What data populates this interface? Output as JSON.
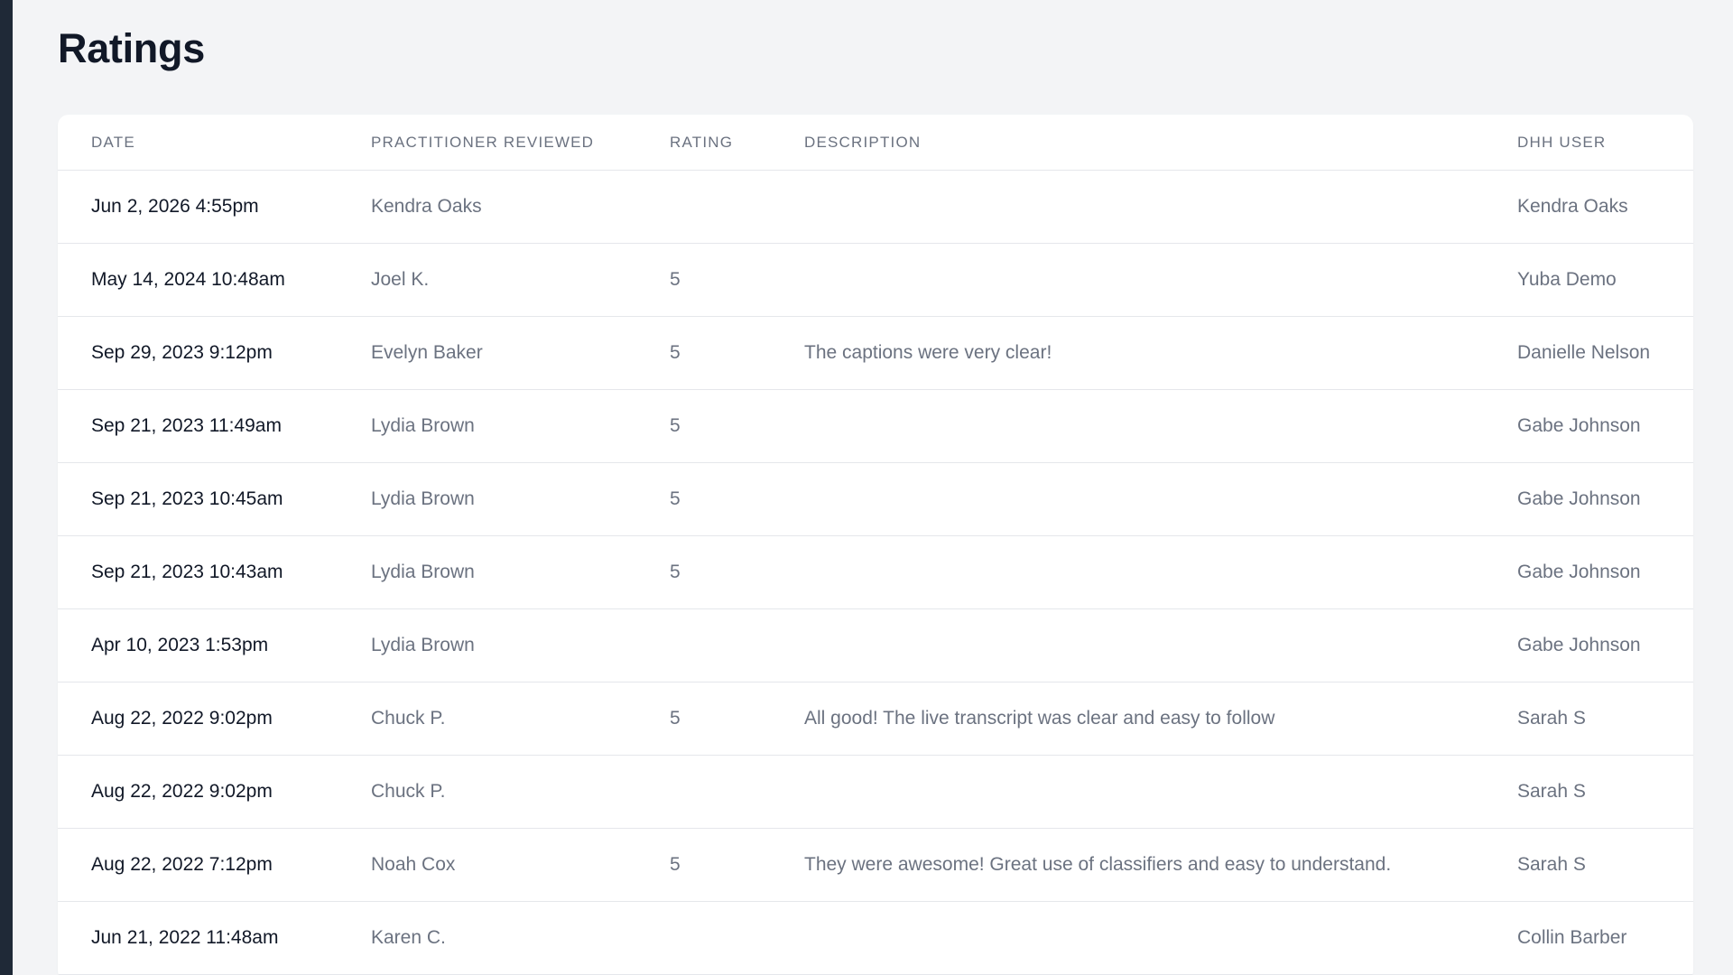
{
  "page": {
    "title": "Ratings"
  },
  "table": {
    "headers": {
      "date": "DATE",
      "practitioner": "PRACTITIONER REVIEWED",
      "rating": "RATING",
      "description": "DESCRIPTION",
      "user": "DHH USER"
    },
    "rows": [
      {
        "date": "Jun 2, 2026 4:55pm",
        "practitioner": "Kendra Oaks",
        "rating": "",
        "description": "",
        "user": "Kendra Oaks"
      },
      {
        "date": "May 14, 2024 10:48am",
        "practitioner": "Joel K.",
        "rating": "5",
        "description": "",
        "user": "Yuba Demo"
      },
      {
        "date": "Sep 29, 2023 9:12pm",
        "practitioner": "Evelyn Baker",
        "rating": "5",
        "description": "The captions were very clear!",
        "user": "Danielle Nelson"
      },
      {
        "date": "Sep 21, 2023 11:49am",
        "practitioner": "Lydia Brown",
        "rating": "5",
        "description": "",
        "user": "Gabe Johnson"
      },
      {
        "date": "Sep 21, 2023 10:45am",
        "practitioner": "Lydia Brown",
        "rating": "5",
        "description": "",
        "user": "Gabe Johnson"
      },
      {
        "date": "Sep 21, 2023 10:43am",
        "practitioner": "Lydia Brown",
        "rating": "5",
        "description": "",
        "user": "Gabe Johnson"
      },
      {
        "date": "Apr 10, 2023 1:53pm",
        "practitioner": "Lydia Brown",
        "rating": "",
        "description": "",
        "user": "Gabe Johnson"
      },
      {
        "date": "Aug 22, 2022 9:02pm",
        "practitioner": "Chuck P.",
        "rating": "5",
        "description": "All good! The live transcript was clear and easy to follow",
        "user": "Sarah S"
      },
      {
        "date": "Aug 22, 2022 9:02pm",
        "practitioner": "Chuck P.",
        "rating": "",
        "description": "",
        "user": "Sarah S"
      },
      {
        "date": "Aug 22, 2022 7:12pm",
        "practitioner": "Noah Cox",
        "rating": "5",
        "description": "They were awesome! Great use of classifiers and easy to understand.",
        "user": "Sarah S"
      },
      {
        "date": "Jun 21, 2022 11:48am",
        "practitioner": "Karen C.",
        "rating": "",
        "description": "",
        "user": "Collin Barber"
      }
    ]
  }
}
